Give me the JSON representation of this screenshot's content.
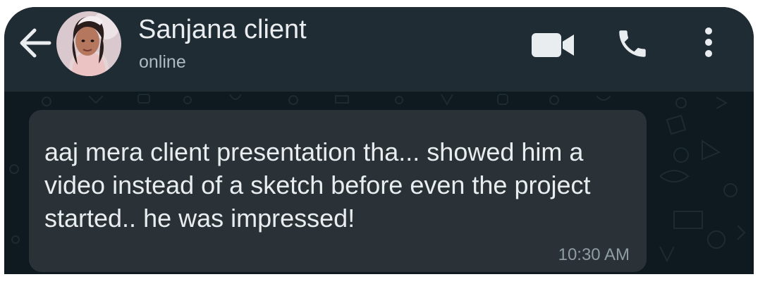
{
  "header": {
    "contact_name": "Sanjana client",
    "status": "online",
    "icons": {
      "back": "back-arrow-icon",
      "avatar": "contact-avatar",
      "video": "video-camera-icon",
      "call": "phone-icon",
      "menu": "more-vertical-icon"
    }
  },
  "messages": [
    {
      "text": "aaj mera client presentation tha... showed him a video instead of a sketch before even the project started.. he was impressed!",
      "time": "10:30 AM",
      "direction": "incoming"
    }
  ],
  "colors": {
    "header_bg": "#202c33",
    "chat_bg": "#0e1a20",
    "bubble_bg": "#2a3237",
    "primary_text": "#e9edef",
    "secondary_text": "#aebac1"
  }
}
